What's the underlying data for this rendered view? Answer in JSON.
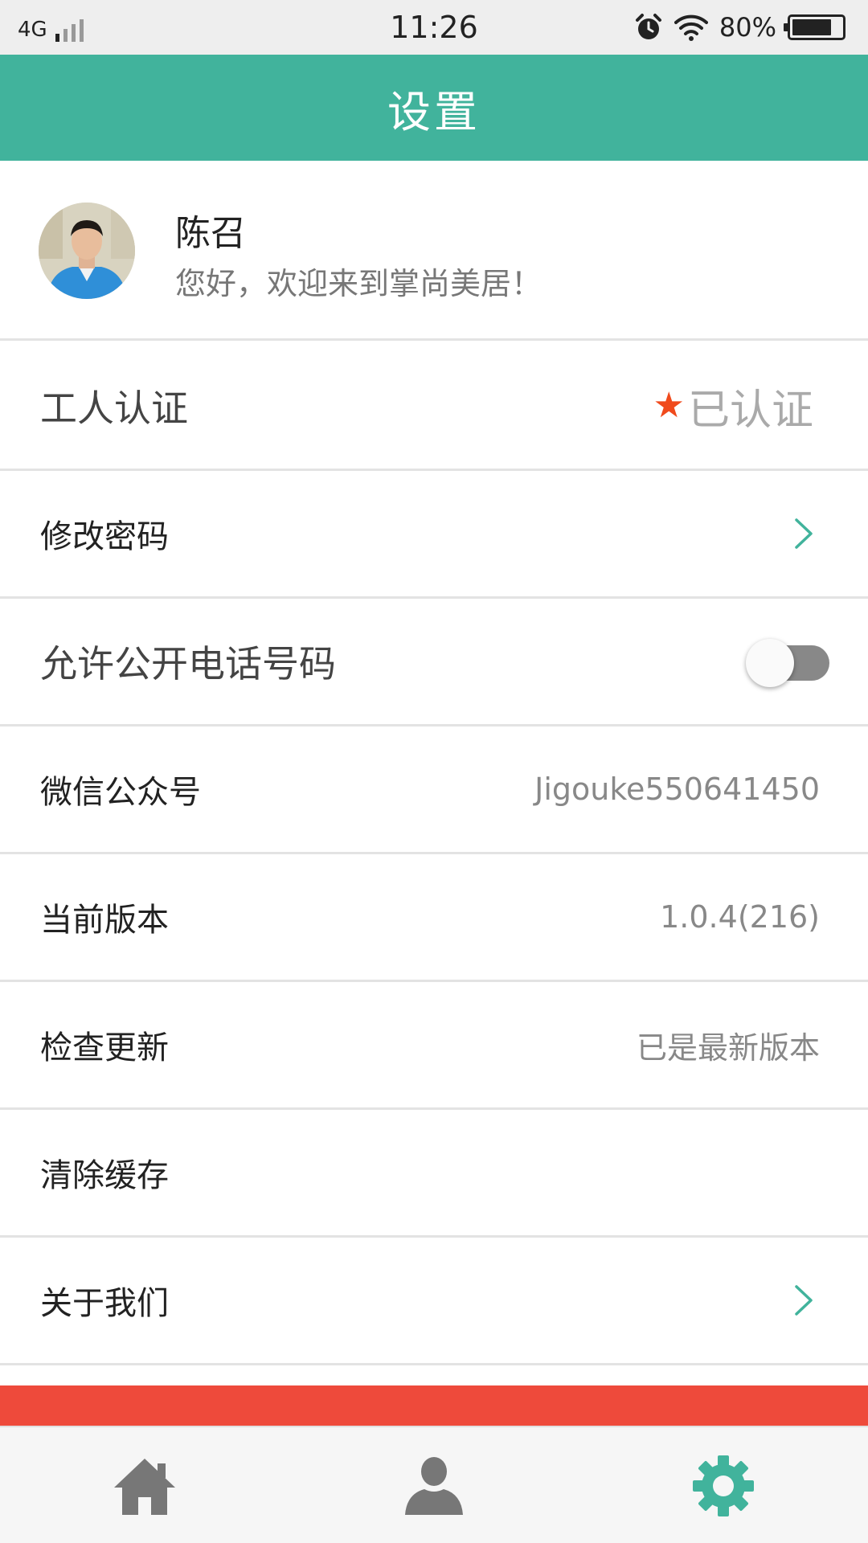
{
  "status_bar": {
    "network": "4G",
    "time": "11:26",
    "battery_percent": "80%",
    "battery_level": 0.8,
    "icons": [
      "signal-icon",
      "alarm-icon",
      "wifi-icon",
      "battery-icon"
    ]
  },
  "header": {
    "title": "设置"
  },
  "profile": {
    "name": "陈召",
    "greeting": "您好，欢迎来到掌尚美居！"
  },
  "settings": {
    "worker_cert_label": "工人认证",
    "worker_cert_status": "已认证",
    "change_password_label": "修改密码",
    "public_phone_label": "允许公开电话号码",
    "public_phone_enabled": false,
    "wechat_label": "微信公众号",
    "wechat_value": "Jigouke550641450",
    "version_label": "当前版本",
    "version_value": "1.0.4(216)",
    "check_update_label": "检查更新",
    "check_update_value": "已是最新版本",
    "clear_cache_label": "清除缓存",
    "about_label": "关于我们"
  },
  "bottom_nav": {
    "items": [
      {
        "icon": "home-icon",
        "active": false
      },
      {
        "icon": "user-icon",
        "active": false
      },
      {
        "icon": "gear-icon",
        "active": true
      }
    ]
  },
  "colors": {
    "accent": "#41b39c",
    "status_star": "#f04a1c",
    "logout": "#ee4a3b",
    "nav_inactive": "#777777"
  }
}
